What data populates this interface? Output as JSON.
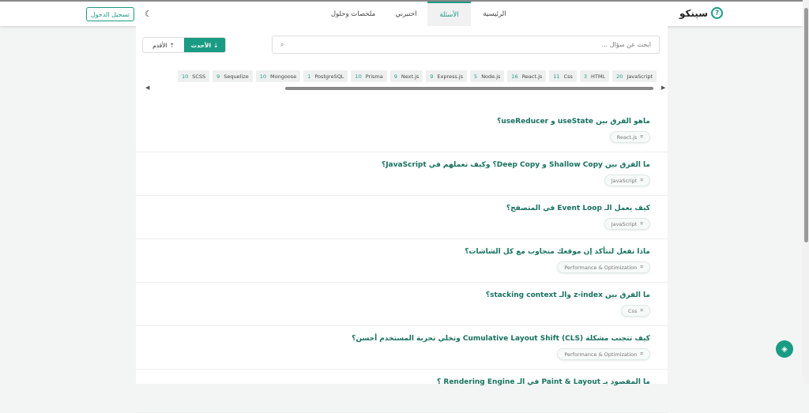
{
  "header": {
    "logo": "سينكو",
    "nav": [
      "الرئيسية",
      "الأسئلة",
      "اختبرني",
      "ملخصات وحلول"
    ],
    "active": 1,
    "login": "تسجيل الدخول"
  },
  "search": {
    "placeholder": "ابحث عن سؤال ..."
  },
  "sort": {
    "newest": "الأحدث",
    "oldest": "الأقدم"
  },
  "tags": [
    {
      "n": "20",
      "l": "JavaScript"
    },
    {
      "n": "3",
      "l": "HTML"
    },
    {
      "n": "11",
      "l": "Css"
    },
    {
      "n": "16",
      "l": "React.js"
    },
    {
      "n": "5",
      "l": "Node.js"
    },
    {
      "n": "9",
      "l": "Express.js"
    },
    {
      "n": "9",
      "l": "Next.js"
    },
    {
      "n": "10",
      "l": "Prisma"
    },
    {
      "n": "1",
      "l": "PostgreSQL"
    },
    {
      "n": "10",
      "l": "Mongoose"
    },
    {
      "n": "9",
      "l": "Sequelize"
    },
    {
      "n": "10",
      "l": "SCSS"
    }
  ],
  "questions": [
    {
      "title": "ماهو الفرق بين useState و useReducer؟",
      "tag": "React.js"
    },
    {
      "title": "ما الفرق بين Shallow Copy و Deep Copy؟ وكيف تعملهم في JavaScript؟",
      "tag": "JavaScript"
    },
    {
      "title": "كيف يعمل الـ Event Loop في المتصفح؟",
      "tag": "JavaScript"
    },
    {
      "title": "ماذا تفعل لتتأكد إن موقعك متجاوب مع كل الشاشات؟",
      "tag": "Performance & Optimization"
    },
    {
      "title": "ما الفرق بين z-index والـ stacking context؟",
      "tag": "Css"
    },
    {
      "title": "كيف تتجنب مشكلة Cumulative Layout Shift (CLS) وتخلي تجربة المستخدم أحسن؟",
      "tag": "Performance & Optimization"
    },
    {
      "title": "ما المقصود بـ Paint & Layout في الـ Rendering Engine ؟",
      "tag": ""
    }
  ]
}
